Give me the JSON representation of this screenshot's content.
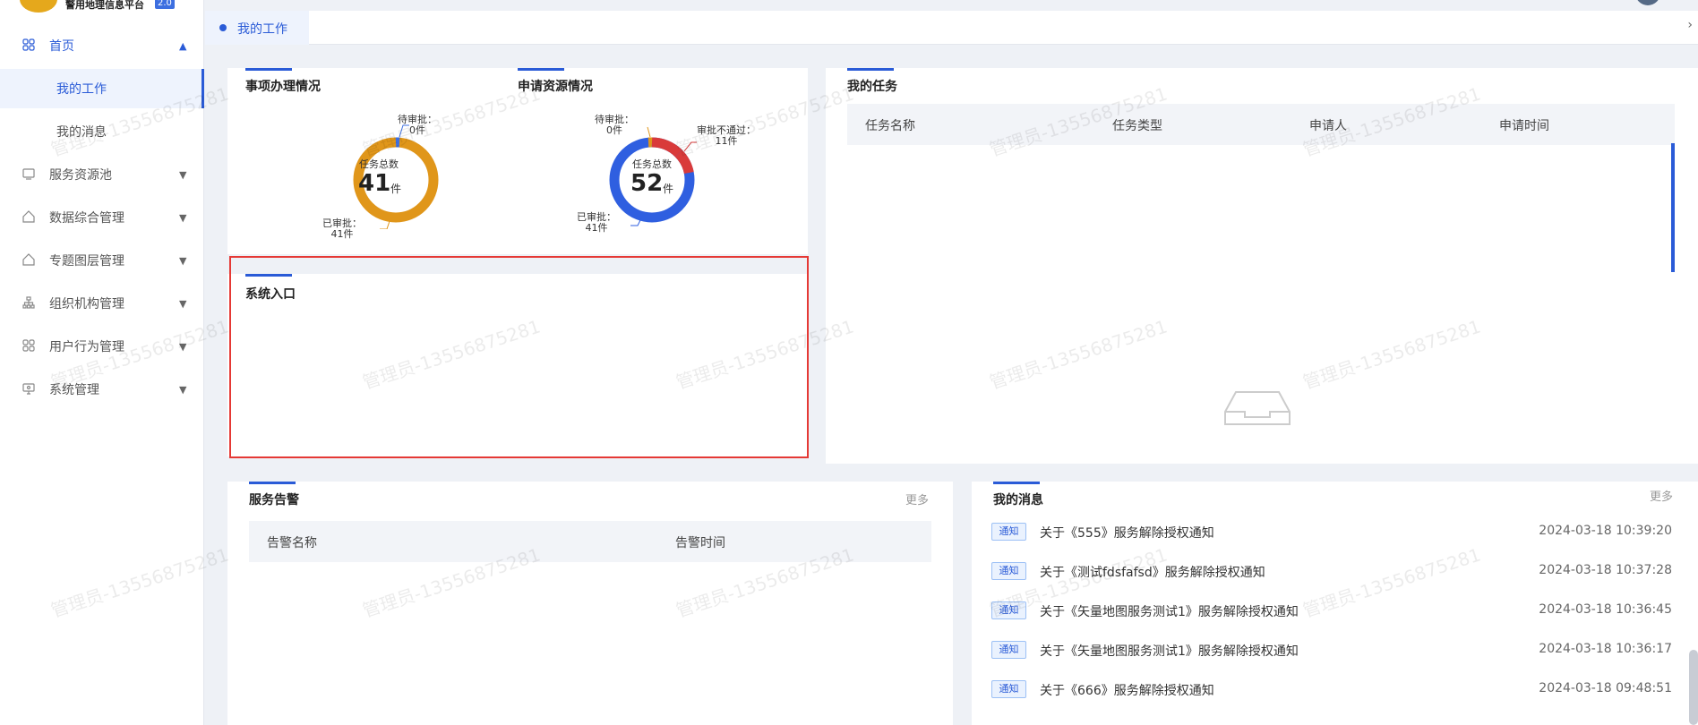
{
  "app": {
    "title": "警用地理信息平台",
    "version": "2.0"
  },
  "sidebar": {
    "items": [
      {
        "label": "首页",
        "icon": "grid-icon",
        "arrow": "▲"
      },
      {
        "label": "我的工作",
        "sub": true
      },
      {
        "label": "我的消息",
        "sub": true
      },
      {
        "label": "服务资源池",
        "icon": "monitor-icon",
        "arrow": "▼"
      },
      {
        "label": "数据综合管理",
        "icon": "home-icon",
        "arrow": "▼"
      },
      {
        "label": "专题图层管理",
        "icon": "home-icon",
        "arrow": "▼"
      },
      {
        "label": "组织机构管理",
        "icon": "org-icon",
        "arrow": "▼"
      },
      {
        "label": "用户行为管理",
        "icon": "grid-icon",
        "arrow": "▼"
      },
      {
        "label": "系统管理",
        "icon": "screen-icon",
        "arrow": "▼"
      }
    ]
  },
  "tabs": [
    {
      "label": "我的工作"
    }
  ],
  "cards": {
    "matters": {
      "title": "事项办理情况",
      "center_label": "任务总数",
      "total": "41",
      "unit": "件",
      "pending": "待审批：",
      "pending_count": "0件",
      "approved": "已审批：",
      "approved_count": "41件"
    },
    "resources": {
      "title": "申请资源情况",
      "center_label": "任务总数",
      "total": "52",
      "unit": "件",
      "pending": "待审批：",
      "pending_count": "0件",
      "rejected": "审批不通过：",
      "rejected_count": "11件",
      "approved": "已审批：",
      "approved_count": "41件"
    },
    "entry": {
      "title": "系统入口"
    },
    "tasks": {
      "title": "我的任务",
      "columns": [
        "任务名称",
        "任务类型",
        "申请人",
        "申请时间"
      ]
    },
    "alerts": {
      "title": "服务告警",
      "more": "更多",
      "columns": [
        "告警名称",
        "告警时间"
      ]
    },
    "messages": {
      "title": "我的消息",
      "more": "更多",
      "items": [
        {
          "tag": "通知",
          "text": "关于《555》服务解除授权通知",
          "time": "2024-03-18 10:39:20"
        },
        {
          "tag": "通知",
          "text": "关于《测试fdsfafsd》服务解除授权通知",
          "time": "2024-03-18 10:37:28"
        },
        {
          "tag": "通知",
          "text": "关于《矢量地图服务测试1》服务解除授权通知",
          "time": "2024-03-18 10:36:45"
        },
        {
          "tag": "通知",
          "text": "关于《矢量地图服务测试1》服务解除授权通知",
          "time": "2024-03-18 10:36:17"
        },
        {
          "tag": "通知",
          "text": "关于《666》服务解除授权通知",
          "time": "2024-03-18 09:48:51"
        }
      ]
    }
  },
  "watermark": "管理员-13556875281",
  "colors": {
    "accent": "#2a5bd7",
    "orange": "#e0961a",
    "red": "#d93a3a",
    "blue": "#2f5fe0"
  }
}
